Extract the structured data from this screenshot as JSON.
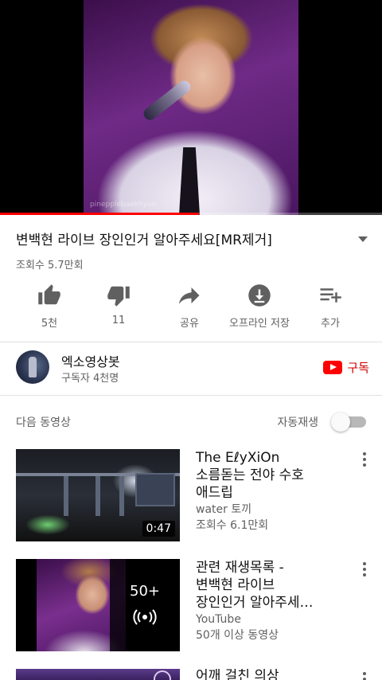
{
  "player": {
    "watermark": "pinepplebaekhyun",
    "progress_fraction": 0.52
  },
  "video": {
    "title": "변백현 라이브 장인인거 알아주세요[MR제거]",
    "views": "조회수 5.7만회"
  },
  "actions": [
    {
      "icon": "thumb-up-icon",
      "label": "5천"
    },
    {
      "icon": "thumb-down-icon",
      "label": "11"
    },
    {
      "icon": "share-icon",
      "label": "공유"
    },
    {
      "icon": "download-icon",
      "label": "오프라인 저장"
    },
    {
      "icon": "add-to-playlist-icon",
      "label": "추가"
    }
  ],
  "channel": {
    "name": "엑소영상봇",
    "subscribers": "구독자 4천명",
    "subscribe_label": "구독"
  },
  "up_next": {
    "label": "다음 동영상",
    "autoplay_label": "자동재생",
    "autoplay_on": false
  },
  "items": [
    {
      "title_line1": "The EℓyXiOn",
      "title_line2": "소름돋는 전야 수호",
      "title_line3": "애드립",
      "channel": "water 토끼",
      "stats": "조회수 6.1만회",
      "duration": "0:47"
    },
    {
      "title_line1": "관련 재생목록 -",
      "title_line2": "변백현 라이브",
      "title_line3": "장인인거 알아주세…",
      "channel": "YouTube",
      "stats": "50개 이상 동영상",
      "playlist_count": "50+"
    },
    {
      "title_line1": "어깨 걸친 의상"
    }
  ],
  "colors": {
    "accent": "#ff0000",
    "subscribe": "#cc0000",
    "secondary_text": "#606060"
  }
}
